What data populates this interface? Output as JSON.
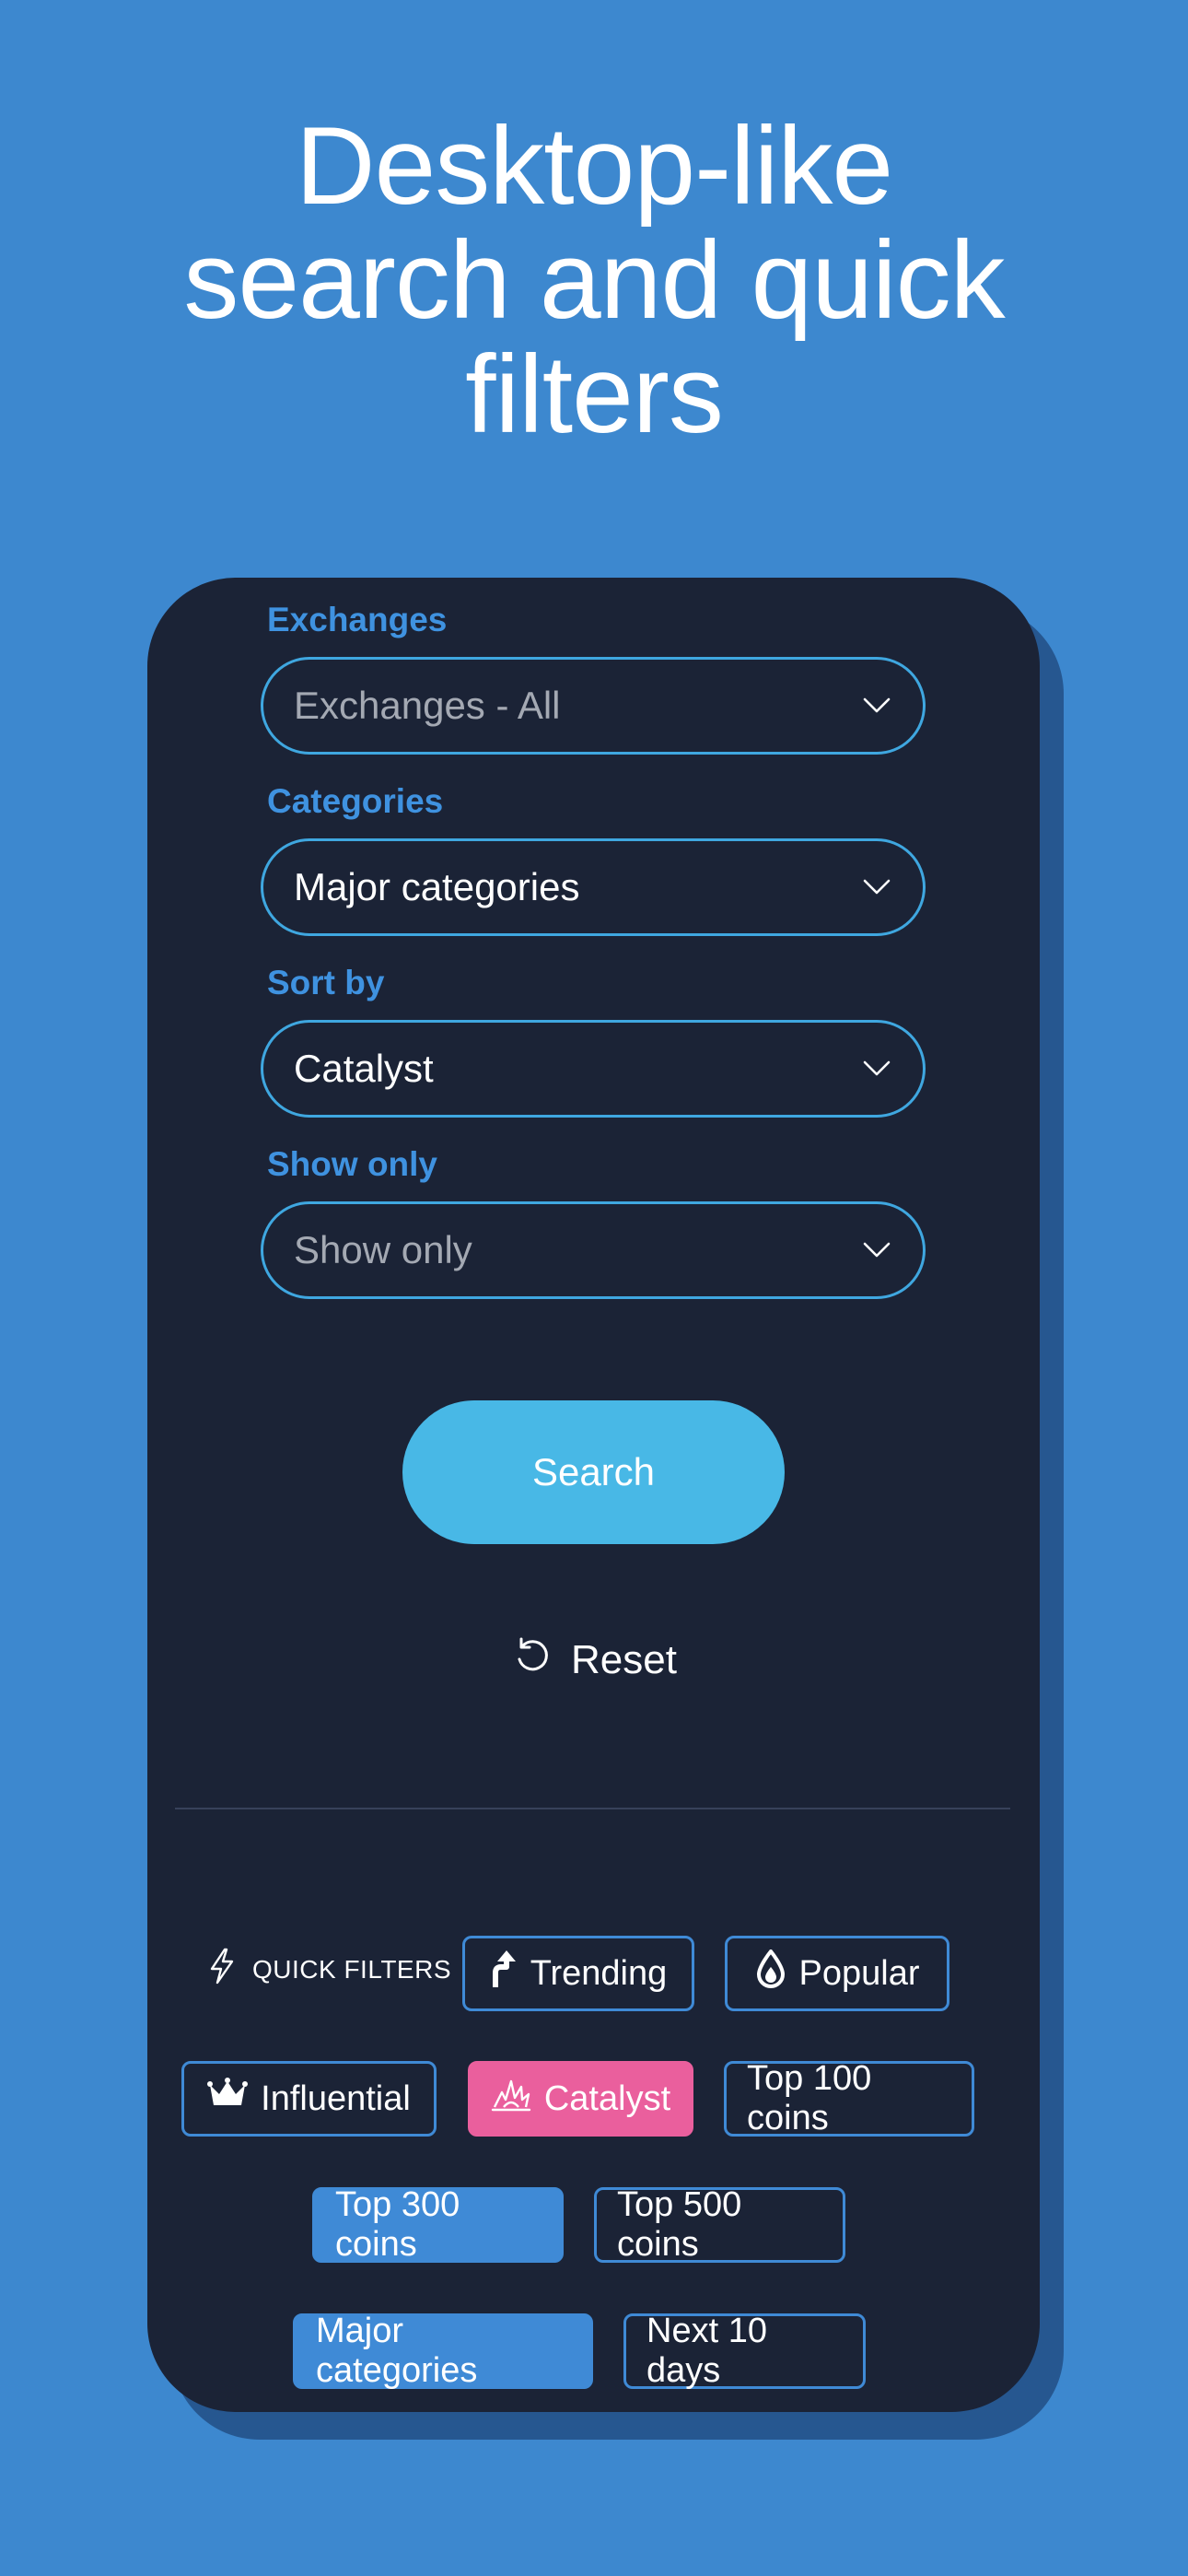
{
  "headline": {
    "line1": "Desktop-like",
    "line2": "search and quick",
    "line3": "filters"
  },
  "form": {
    "exchanges": {
      "label": "Exchanges",
      "value": "Exchanges - All"
    },
    "categories": {
      "label": "Categories",
      "value": "Major categories"
    },
    "sort_by": {
      "label": "Sort by",
      "value": "Catalyst"
    },
    "show_only": {
      "label": "Show only",
      "value": "Show only"
    }
  },
  "actions": {
    "search_label": "Search",
    "reset_label": "Reset"
  },
  "quick_filters": {
    "label": "QUICK FILTERS",
    "chips": [
      {
        "label": "Trending",
        "icon": "trending-arrow-icon",
        "style": "outline"
      },
      {
        "label": "Popular",
        "icon": "drop-icon",
        "style": "outline"
      },
      {
        "label": "Influential",
        "icon": "crown-icon",
        "style": "outline"
      },
      {
        "label": "Catalyst",
        "icon": "explosion-icon",
        "style": "pink"
      },
      {
        "label": "Top 100 coins",
        "style": "outline"
      },
      {
        "label": "Top 300 coins",
        "style": "blue"
      },
      {
        "label": "Top 500 coins",
        "style": "outline"
      },
      {
        "label": "Major categories",
        "style": "blue"
      },
      {
        "label": "Next 10 days",
        "style": "outline"
      }
    ]
  },
  "colors": {
    "background": "#3d88cf",
    "card": "#1b2336",
    "accent_label": "#3f92e0",
    "select_border": "#3fa7e0",
    "search_button": "#48b8e6",
    "chip_blue": "#3f8ad6",
    "chip_pink": "#ea5f9d"
  }
}
